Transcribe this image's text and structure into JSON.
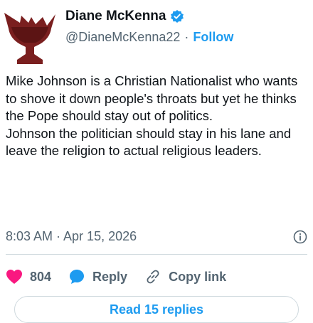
{
  "author": {
    "display_name": "Diane McKenna",
    "handle": "@DianeMcKenna22",
    "separator": "·",
    "follow_label": "Follow",
    "verified": true,
    "avatar_icon": "goblet-avatar"
  },
  "tweet": {
    "lines": [
      "Mike Johnson is a Christian Nationalist who wants to shove it down people's throats but yet he thinks the Pope should stay out of politics.",
      "Johnson the politician should stay in his lane and leave the religion to actual religious leaders."
    ],
    "timestamp": "8:03 AM · Apr 15, 2026"
  },
  "actions": {
    "like_count": "804",
    "reply_label": "Reply",
    "copy_link_label": "Copy link"
  },
  "footer": {
    "read_replies_label": "Read 15 replies"
  },
  "colors": {
    "accent": "#1d9bf0",
    "like": "#f91880",
    "text": "#0f1419",
    "muted": "#536471"
  }
}
